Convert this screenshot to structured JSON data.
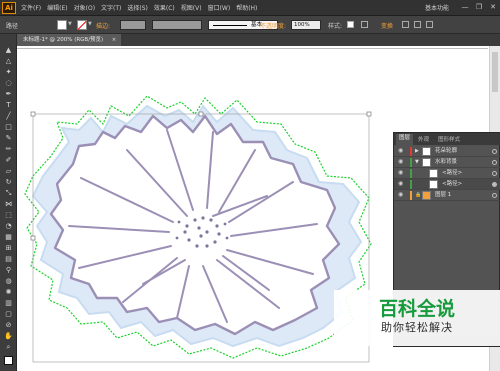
{
  "app": {
    "logo": "Ai",
    "workspace": "基本功能"
  },
  "menu": [
    "文件(F)",
    "编辑(E)",
    "对象(O)",
    "文字(T)",
    "选择(S)",
    "效果(C)",
    "视图(V)",
    "窗口(W)",
    "帮助(H)"
  ],
  "window_buttons": {
    "minimize": "—",
    "restore": "❐",
    "close": "✕"
  },
  "control_bar": {
    "mode_label": "路径",
    "stroke_label": "描边:",
    "brush_value": "基本",
    "opacity_label": "不透明度:",
    "opacity_value": "100%",
    "style_label": "样式:",
    "transform_label": "变换"
  },
  "document_tab": {
    "title": "未标题-1* @ 200% (RGB/预览)",
    "close": "×"
  },
  "layers_panel": {
    "tabs": [
      "图层",
      "外观",
      "图形样式"
    ],
    "rows": [
      {
        "name": "花朵轮廓",
        "color": "#e53935",
        "expanded": false
      },
      {
        "name": "水彩背景",
        "color": "#43a047",
        "expanded": true
      },
      {
        "name": "<路径>",
        "color": "#43a047",
        "expanded": false
      },
      {
        "name": "<路径>",
        "color": "#43a047",
        "expanded": false
      },
      {
        "name": "图层 1",
        "color": "#f2a13a",
        "expanded": false
      }
    ]
  },
  "tool_icons": [
    "selection-icon",
    "direct-selection-icon",
    "magic-wand-icon",
    "lasso-icon",
    "pen-icon",
    "type-icon",
    "line-icon",
    "rectangle-icon",
    "paintbrush-icon",
    "pencil-icon",
    "blob-brush-icon",
    "eraser-icon",
    "rotate-icon",
    "scale-icon",
    "width-icon",
    "free-transform-icon",
    "shape-builder-icon",
    "perspective-icon",
    "mesh-icon",
    "gradient-icon",
    "eyedropper-icon",
    "blend-icon",
    "symbol-sprayer-icon",
    "column-graph-icon",
    "artboard-icon",
    "slice-icon",
    "hand-icon",
    "zoom-icon"
  ],
  "watermark": {
    "title": "百科全说",
    "subtitle": "助你轻松解决"
  }
}
